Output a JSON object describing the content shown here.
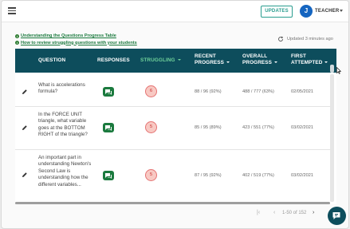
{
  "topbar": {
    "updates_label": "UPDATES",
    "avatar_initial": "J",
    "role_label": "TEACHER"
  },
  "links": [
    "Understanding the Questions Progress Table",
    "How to review struggling questions with your students"
  ],
  "updated_text": "Updated 3 minutes ago",
  "table": {
    "headers": {
      "question": "QUESTION",
      "responses": "RESPONSES",
      "struggling": "STRUGGLING",
      "recent_progress_1": "RECENT",
      "recent_progress_2": "PROGRESS",
      "overall_progress_1": "OVERALL",
      "overall_progress_2": "PROGRESS",
      "first_attempted_1": "FIRST",
      "first_attempted_2": "ATTEMPTED"
    },
    "rows": [
      {
        "question": "What is accelerations formula?",
        "struggling": "6",
        "recent": "88 / 96 (92%)",
        "overall": "488 / 777 (63%)",
        "first": "02/05/2021"
      },
      {
        "question": "In the FORCE UNIT triangle, what variable goes at the BOTTOM RIGHT of the triangle?",
        "struggling": "5",
        "recent": "85 / 95 (89%)",
        "overall": "423 / 551 (77%)",
        "first": "03/02/2021"
      },
      {
        "question": "An important part in understanding Newton's Second Law is understanding how the different variables...",
        "struggling": "5",
        "recent": "87 / 95 (92%)",
        "overall": "402 / 519 (77%)",
        "first": "03/02/2021"
      }
    ]
  },
  "pager": {
    "range": "1-50 of 152"
  },
  "icons": {
    "menu": "menu-icon",
    "refresh": "refresh-icon",
    "edit": "pencil-icon",
    "responses": "chat-bubble-icon",
    "help": "help-chat-icon"
  },
  "colors": {
    "header_bg": "#0d4d5c",
    "accent_green": "#1b7a3e",
    "struggling_header": "#6fd19a",
    "struggling_badge": "#f8c9c3",
    "avatar": "#1565c0"
  }
}
